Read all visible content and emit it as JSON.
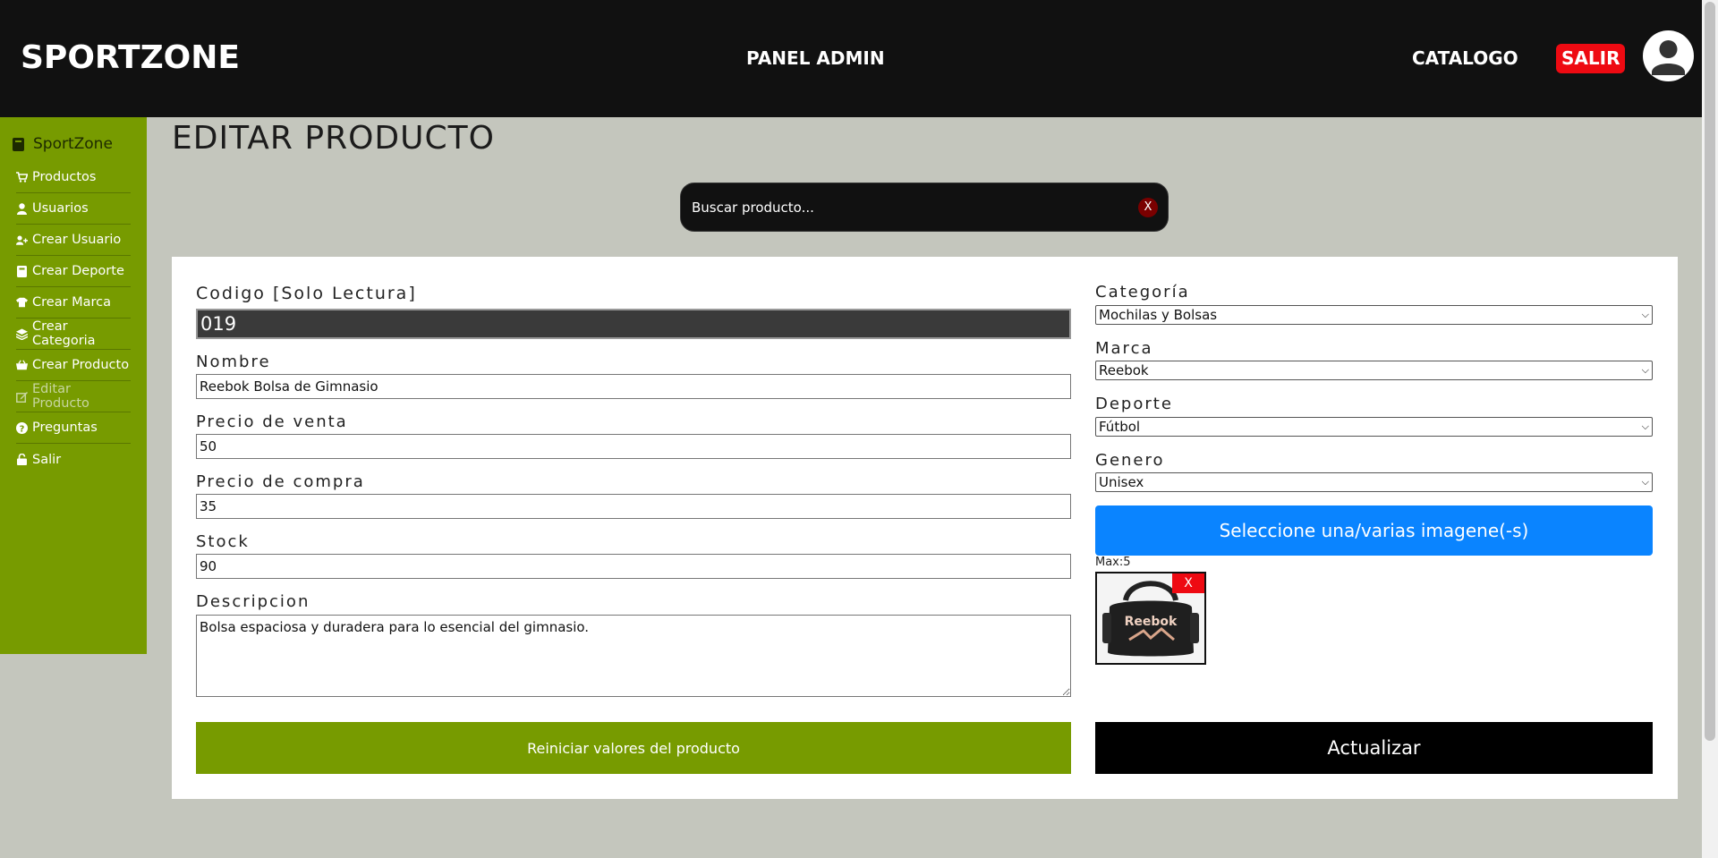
{
  "header": {
    "brand": "SPORTZONE",
    "center_title": "PANEL ADMIN",
    "catalog_link": "CATALOGO",
    "logout_label": "SALIR",
    "avatar_icon": "user-avatar-icon"
  },
  "sidebar": {
    "brand": "SportZone",
    "brand_icon": "book-icon",
    "items": [
      {
        "label": "Productos",
        "icon": "cart-icon"
      },
      {
        "label": "Usuarios",
        "icon": "user-icon"
      },
      {
        "label": "Crear Usuario",
        "icon": "user-plus-icon"
      },
      {
        "label": "Crear Deporte",
        "icon": "book-icon"
      },
      {
        "label": "Crear Marca",
        "icon": "shirt-icon"
      },
      {
        "label": "Crear Categoria",
        "icon": "layers-icon"
      },
      {
        "label": "Crear Producto",
        "icon": "basket-icon"
      },
      {
        "label": "Editar Producto",
        "icon": "edit-icon",
        "active": true
      },
      {
        "label": "Preguntas",
        "icon": "question-icon"
      },
      {
        "label": "Salir",
        "icon": "lock-icon"
      }
    ]
  },
  "page": {
    "title": "EDITAR PRODUCTO"
  },
  "search": {
    "placeholder": "Buscar producto...",
    "clear_label": "X"
  },
  "form": {
    "codigo": {
      "label": "Codigo [Solo Lectura]",
      "value": "019"
    },
    "nombre": {
      "label": "Nombre",
      "value": "Reebok Bolsa de Gimnasio"
    },
    "precio_venta": {
      "label": "Precio de venta",
      "value": "50"
    },
    "precio_compra": {
      "label": "Precio de compra",
      "value": "35"
    },
    "stock": {
      "label": "Stock",
      "value": "90"
    },
    "descripcion": {
      "label": "Descripcion",
      "value": "Bolsa espaciosa y duradera para lo esencial del gimnasio."
    },
    "categoria": {
      "label": "Categoría",
      "value": "Mochilas y Bolsas"
    },
    "marca": {
      "label": "Marca",
      "value": "Reebok"
    },
    "deporte": {
      "label": "Deporte",
      "value": "Fútbol"
    },
    "genero": {
      "label": "Genero",
      "value": "Unisex"
    },
    "upload_label": "Seleccione una/varias imagene(-s)",
    "max_text": "Max:5",
    "image_remove_label": "X",
    "image_logo_text": "Reebok",
    "reset_label": "Reiniciar valores del producto",
    "update_label": "Actualizar"
  },
  "colors": {
    "header_bg": "#111111",
    "sidebar_bg": "#779b00",
    "page_bg": "#c4c6bd",
    "accent_blue": "#0a84ff",
    "danger_red": "#ee0a12"
  }
}
